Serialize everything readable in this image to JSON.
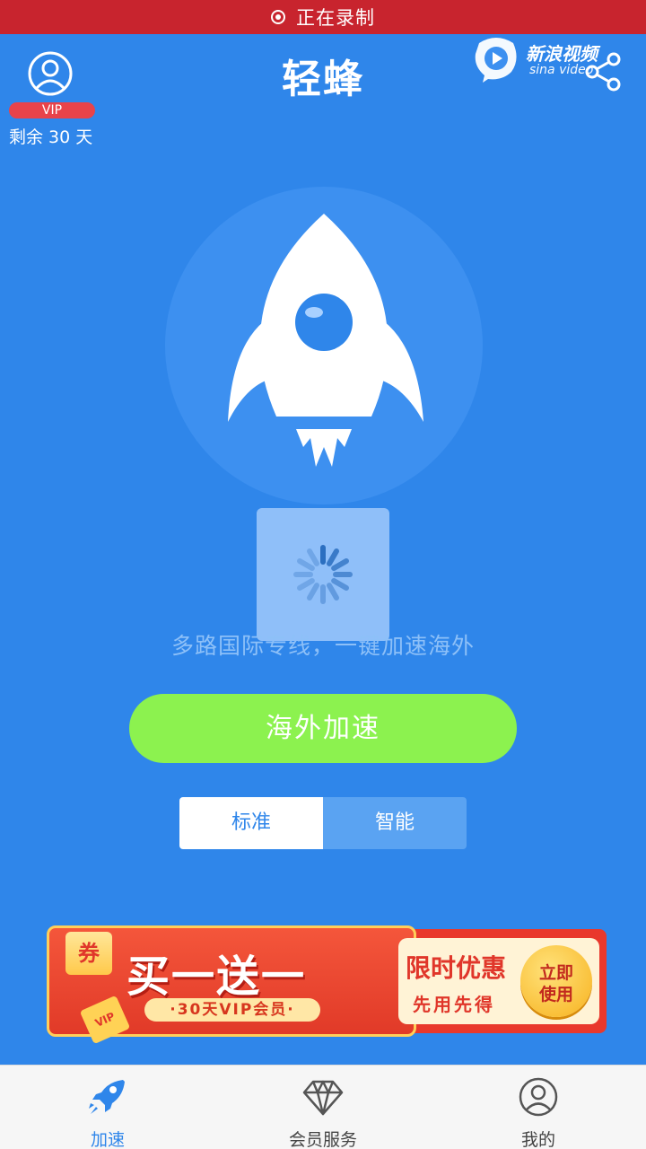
{
  "status_bar": {
    "recording_text": "正在录制"
  },
  "header": {
    "title": "轻蜂",
    "vip_badge": "VIP",
    "remaining": "剩余 30 天",
    "watermark_title": "新浪视频",
    "watermark_sub": "sina video"
  },
  "main": {
    "slogan": "多路国际专线，一键加速海外",
    "accelerate_button": "海外加速",
    "modes": [
      "标准",
      "智能"
    ],
    "selected_mode": "标准"
  },
  "banner": {
    "coupon": "券",
    "headline": "买一送一",
    "subline": "·30天VIP会员·",
    "vip_ribbon": "VIP",
    "promo_title": "限时优惠",
    "promo_sub": "先用先得",
    "use_button_line1": "立即",
    "use_button_line2": "使用"
  },
  "tabbar": {
    "tabs": [
      {
        "label": "加速",
        "active": true
      },
      {
        "label": "会员服务",
        "active": false
      },
      {
        "label": "我的",
        "active": false
      }
    ]
  },
  "colors": {
    "background": "#2f86ea",
    "record_bar": "#c8242e",
    "accelerate_button": "#8cf24f",
    "vip_badge": "#e8434a",
    "active_tab": "#2f86ea"
  }
}
